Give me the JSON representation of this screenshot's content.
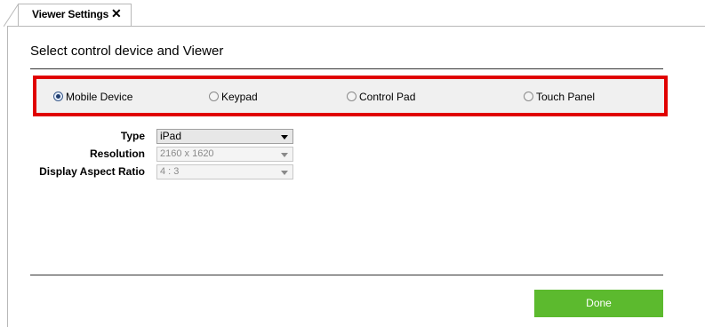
{
  "tab": {
    "title": "Viewer Settings",
    "close_glyph": "✕"
  },
  "page": {
    "heading": "Select control device and Viewer"
  },
  "device_options": [
    {
      "label": "Mobile Device",
      "selected": true
    },
    {
      "label": "Keypad",
      "selected": false
    },
    {
      "label": "Control Pad",
      "selected": false
    },
    {
      "label": "Touch Panel",
      "selected": false
    }
  ],
  "form": {
    "type": {
      "label": "Type",
      "value": "iPad",
      "enabled": true
    },
    "resolution": {
      "label": "Resolution",
      "value": "2160 x 1620",
      "enabled": false
    },
    "aspect": {
      "label": "Display Aspect Ratio",
      "value": "4 : 3",
      "enabled": false
    }
  },
  "done_button": {
    "label": "Done",
    "color": "#5cba2e"
  },
  "highlight_color": "#e00000"
}
